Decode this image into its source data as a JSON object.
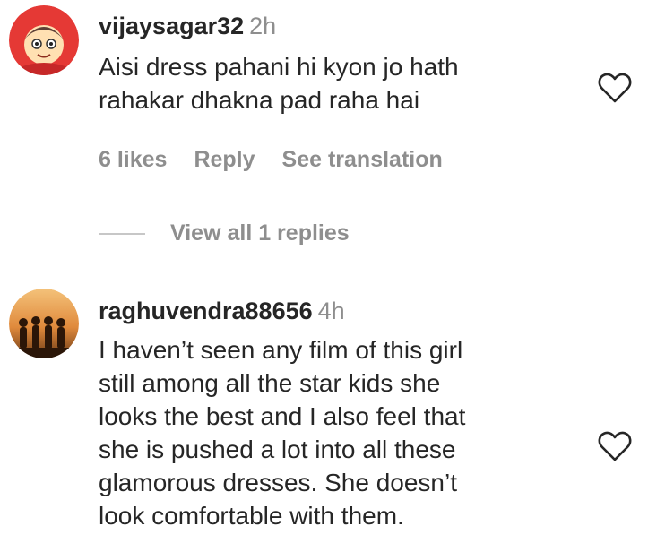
{
  "comments": [
    {
      "username": "vijaysagar32",
      "time": "2h",
      "text_lines": [
        "Aisi dress pahani hi kyon jo hath",
        "rahakar dhakna pad raha hai"
      ],
      "likes": "6 likes",
      "reply_label": "Reply",
      "translate_label": "See translation",
      "view_replies": "View all 1 replies",
      "avatar_icon": "cartoon-boy-avatar-icon",
      "like_icon": "heart-outline-icon"
    },
    {
      "username": "raghuvendra88656",
      "time": "4h",
      "text_lines": [
        "I haven’t seen any film of this girl",
        "still among all the star kids she",
        "looks the best and I also feel that",
        "she is pushed a lot into all these",
        "glamorous dresses. She doesn’t",
        "look comfortable with them."
      ],
      "avatar_icon": "silhouette-group-avatar-icon",
      "like_icon": "heart-outline-icon"
    }
  ],
  "colors": {
    "primary_text": "#262626",
    "secondary_text": "#8e8e8e",
    "avatar1_bg": "#e53935",
    "avatar2_bg": "#b5651d"
  }
}
